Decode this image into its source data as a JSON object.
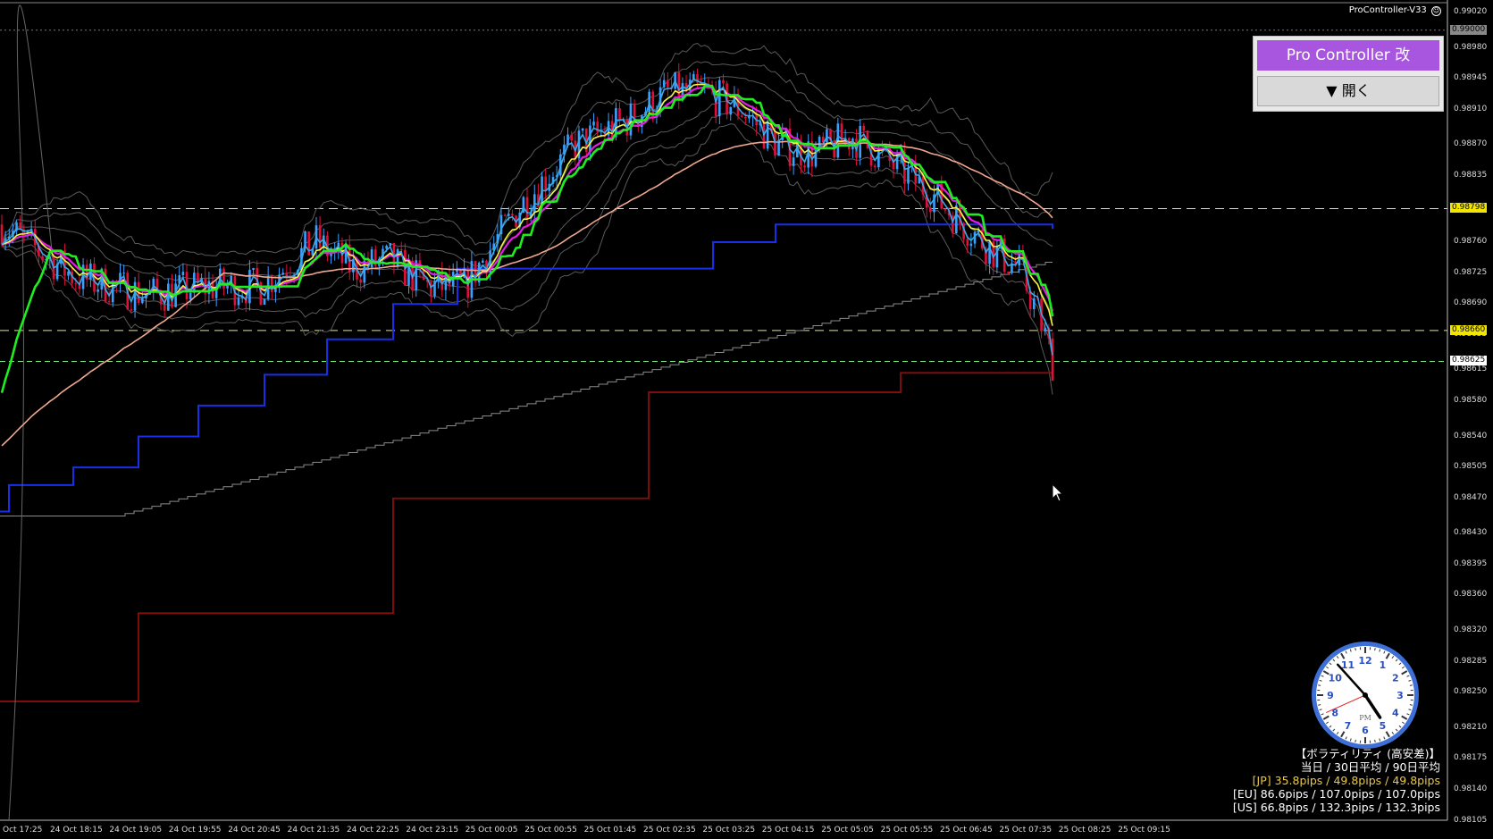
{
  "indicator_label": "ProController-V33",
  "pro_controller": {
    "title": "Pro Controller 改",
    "open_button": "▼ 開く"
  },
  "price_axis": {
    "ticks": [
      "0.99020",
      "0.98980",
      "0.98945",
      "0.98910",
      "0.98870",
      "0.98835",
      "0.98760",
      "0.98725",
      "0.98690",
      "0.98655",
      "0.98615",
      "0.98580",
      "0.98540",
      "0.98505",
      "0.98470",
      "0.98430",
      "0.98395",
      "0.98360",
      "0.98320",
      "0.98285",
      "0.98250",
      "0.98210",
      "0.98175",
      "0.98140",
      "0.98105"
    ],
    "tags": [
      {
        "label": "0.99000",
        "color": "#888888",
        "text": "#000000"
      },
      {
        "label": "0.98798",
        "color": "#f2e600",
        "text": "#000000"
      },
      {
        "label": "0.98660",
        "color": "#f2e600",
        "text": "#000000"
      },
      {
        "label": "0.98625",
        "color": "#ffffff",
        "text": "#000000"
      }
    ]
  },
  "time_axis": [
    "Oct 17:25",
    "24 Oct 18:15",
    "24 Oct 19:05",
    "24 Oct 19:55",
    "24 Oct 20:45",
    "24 Oct 21:35",
    "24 Oct 22:25",
    "24 Oct 23:15",
    "25 Oct 00:05",
    "25 Oct 00:55",
    "25 Oct 01:45",
    "25 Oct 02:35",
    "25 Oct 03:25",
    "25 Oct 04:15",
    "25 Oct 05:05",
    "25 Oct 05:55",
    "25 Oct 06:45",
    "25 Oct 07:35",
    "25 Oct 08:25",
    "25 Oct 09:15"
  ],
  "volatility": {
    "title": "【ボラティリティ (高安差)】",
    "subtitle": "当日 / 30日平均 / 90日平均",
    "jp": "[JP] 35.8pips / 49.8pips / 49.8pips",
    "eu": "[EU] 86.6pips / 107.0pips / 107.0pips",
    "us": "[US] 66.8pips / 132.3pips / 132.3pips"
  },
  "clock": {
    "numbers": [
      "12",
      "1",
      "2",
      "3",
      "4",
      "5",
      "6",
      "7",
      "8",
      "9",
      "10",
      "11"
    ],
    "period": "PM",
    "hour": 4,
    "minute": 53,
    "second": 41
  },
  "colors": {
    "bull": "#3aa0ff",
    "bear": "#e0103a",
    "ema_fast": "#39a9e8",
    "ema_mid": "#f5f542",
    "ema_slow": "#e21ee0",
    "trend_green": "#1eee1e",
    "ma_long": "#f0a890",
    "blue_step": "#1a2ee8",
    "darkred_step": "#8a0d0d",
    "grey_step": "#8a8a8a",
    "bands": "#5a5a5a",
    "hline_yellow": "#e6e67a",
    "hline_green": "#7ee67e"
  }
}
